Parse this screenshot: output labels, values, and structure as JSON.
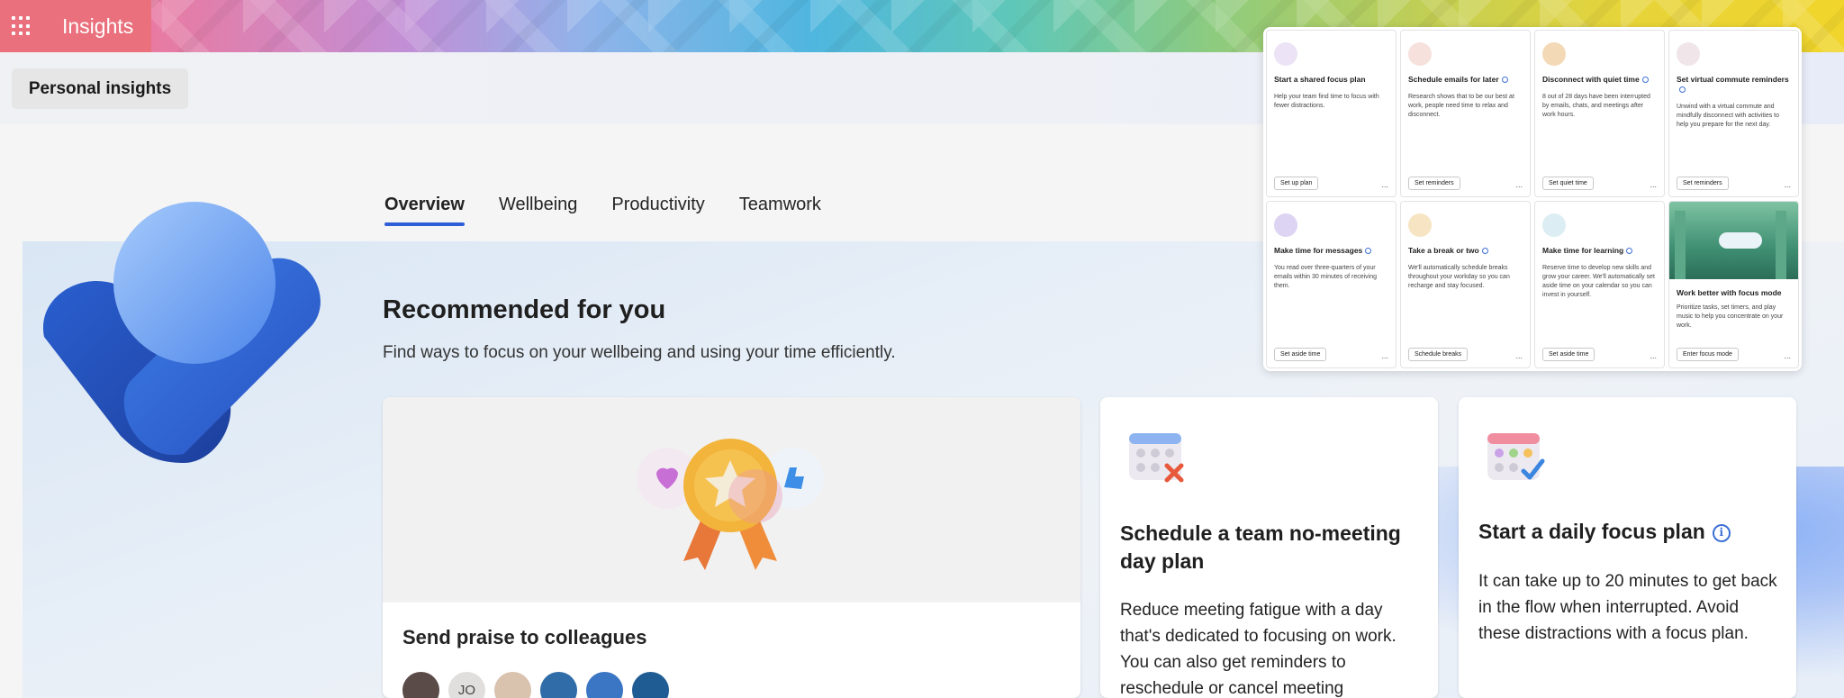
{
  "app": {
    "title": "Insights",
    "page_button": "Personal insights"
  },
  "tabs": [
    {
      "label": "Overview",
      "active": true
    },
    {
      "label": "Wellbeing",
      "active": false
    },
    {
      "label": "Productivity",
      "active": false
    },
    {
      "label": "Teamwork",
      "active": false
    }
  ],
  "recommended": {
    "title": "Recommended for you",
    "subtitle": "Find ways to focus on your wellbeing and using your time efficiently."
  },
  "cards": {
    "praise": {
      "title": "Send praise to colleagues",
      "avatars": [
        "",
        "JO",
        "",
        "",
        "",
        ""
      ]
    },
    "no_meeting": {
      "title": "Schedule a team no-meeting day plan",
      "description": "Reduce meeting fatigue with a day that's dedicated to focusing on work. You can also get reminders to reschedule or cancel meeting"
    },
    "focus_plan": {
      "title": "Start a daily focus plan",
      "description": "It can take up to 20 minutes to get back in the flow when interrupted. Avoid these distractions with a focus plan."
    }
  },
  "overlay_cards": [
    {
      "title": "Start a shared focus plan",
      "info": false,
      "description": "Help your team find time to focus with fewer distractions.",
      "button": "Set up plan",
      "more": "..."
    },
    {
      "title": "Schedule emails for later",
      "info": true,
      "description": "Research shows that to be our best at work, people need time to relax and disconnect.",
      "button": "Set reminders",
      "more": "..."
    },
    {
      "title": "Disconnect with quiet time",
      "info": true,
      "description": "8 out of 28 days have been interrupted by emails, chats, and meetings after work hours.",
      "button": "Set quiet time",
      "more": "..."
    },
    {
      "title": "Set virtual commute reminders",
      "info": true,
      "description": "Unwind with a virtual commute and mindfully disconnect with activities to help you prepare for the next day.",
      "button": "Set reminders",
      "more": "..."
    },
    {
      "title": "Make time for messages",
      "info": true,
      "description": "You read over three-quarters of your emails within 30 minutes of receiving them.",
      "button": "Set aside time",
      "more": "..."
    },
    {
      "title": "Take a break or two",
      "info": true,
      "description": "We'll automatically schedule breaks throughout your workday so you can recharge and stay focused.",
      "button": "Schedule breaks",
      "more": "..."
    },
    {
      "title": "Make time for learning",
      "info": true,
      "description": "Reserve time to develop new skills and grow your career. We'll automatically set aside time on your calendar so you can invest in yourself.",
      "button": "Set aside time",
      "more": "..."
    },
    {
      "title": "Work better with focus mode",
      "info": false,
      "description": "Prioritize tasks, set timers, and play music to help you concentrate on your work.",
      "button": "Enter focus mode",
      "more": "..."
    }
  ],
  "colors": {
    "accent": "#2f5fd6",
    "app_tile": "#e9707c"
  }
}
